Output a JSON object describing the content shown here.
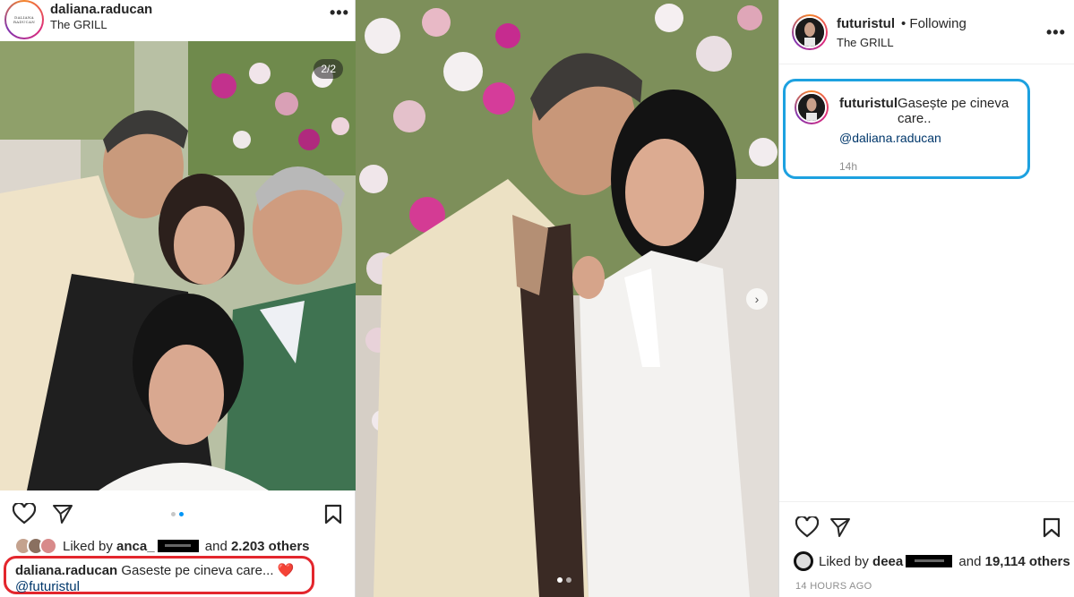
{
  "left_post": {
    "username": "daliana.raducan",
    "location": "The GRILL",
    "avatar_logo_text": "DALIANA RADUCAN",
    "more_icon": "more-horizontal-icon",
    "photo_counter": "2/2",
    "likes_prefix": "Liked by",
    "likes_user": "anca_",
    "likes_suffix": "and",
    "likes_count": "2.203 others",
    "caption_username": "daliana.raducan",
    "caption_text": "Gaseste pe cineva care...",
    "caption_emoji": "❤️",
    "caption_mention": "@futuristul",
    "caption_outline_color": "#e3262d",
    "pagination_active": 2,
    "pagination_total": 2
  },
  "middle_photo": {
    "next_icon": "chevron-right-icon",
    "pagination_active": 1,
    "pagination_total": 2
  },
  "right_panel": {
    "username": "futuristul",
    "follow_status": "Following",
    "location": "The GRILL",
    "more_icon": "more-horizontal-icon",
    "comment_username": "futuristul",
    "comment_text": "Gasește pe cineva care..",
    "comment_mention": "@daliana.raducan",
    "comment_time": "14h",
    "comment_outline_color": "#1da1e0",
    "likes_prefix": "Liked by",
    "likes_user": "deea",
    "likes_suffix": "and",
    "likes_count": "19,114 others",
    "time_ago": "14 HOURS AGO"
  },
  "colors": {
    "link": "#00376b",
    "accent_blue": "#0095f6",
    "muted": "#8e8e8e"
  }
}
